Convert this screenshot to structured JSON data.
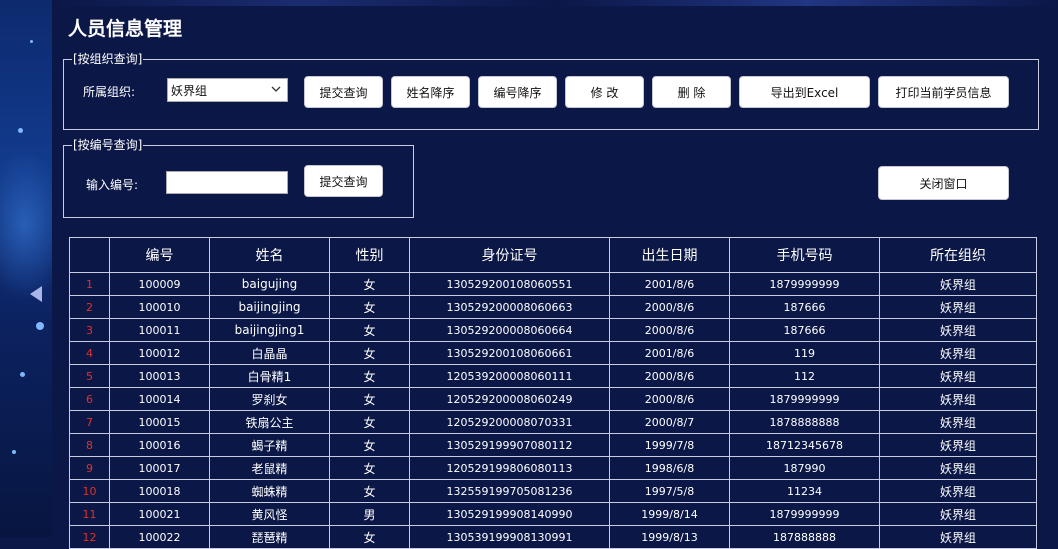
{
  "page": {
    "title": "人员信息管理"
  },
  "org_query": {
    "legend": "[按组织查询]",
    "org_label": "所属组织:",
    "org_select_value": "妖界组",
    "buttons": {
      "submit": "提交查询",
      "sort_name": "姓名降序",
      "sort_id": "编号降序",
      "edit": "修 改",
      "delete": "删 除",
      "export": "导出到Excel",
      "print": "打印当前学员信息"
    }
  },
  "id_query": {
    "legend": "[按编号查询]",
    "id_label": "输入编号:",
    "id_value": "",
    "submit": "提交查询"
  },
  "close_window": "关闭窗口",
  "table": {
    "headers": [
      "编号",
      "姓名",
      "性别",
      "身份证号",
      "出生日期",
      "手机号码",
      "所在组织"
    ],
    "rows": [
      {
        "n": "1",
        "id": "100009",
        "name": "baigujing",
        "gender": "女",
        "idcard": "130529200108060551",
        "birth": "2001/8/6",
        "phone": "1879999999",
        "org": "妖界组"
      },
      {
        "n": "2",
        "id": "100010",
        "name": "baijingjing",
        "gender": "女",
        "idcard": "130529200008060663",
        "birth": "2000/8/6",
        "phone": "187666",
        "org": "妖界组"
      },
      {
        "n": "3",
        "id": "100011",
        "name": "baijingjing1",
        "gender": "女",
        "idcard": "130529200008060664",
        "birth": "2000/8/6",
        "phone": "187666",
        "org": "妖界组"
      },
      {
        "n": "4",
        "id": "100012",
        "name": "白晶晶",
        "gender": "女",
        "idcard": "130529200108060661",
        "birth": "2001/8/6",
        "phone": "119",
        "org": "妖界组"
      },
      {
        "n": "5",
        "id": "100013",
        "name": "白骨精1",
        "gender": "女",
        "idcard": "120539200008060111",
        "birth": "2000/8/6",
        "phone": "112",
        "org": "妖界组"
      },
      {
        "n": "6",
        "id": "100014",
        "name": "罗刹女",
        "gender": "女",
        "idcard": "120529200008060249",
        "birth": "2000/8/6",
        "phone": "1879999999",
        "org": "妖界组"
      },
      {
        "n": "7",
        "id": "100015",
        "name": "铁扇公主",
        "gender": "女",
        "idcard": "120529200008070331",
        "birth": "2000/8/7",
        "phone": "1878888888",
        "org": "妖界组"
      },
      {
        "n": "8",
        "id": "100016",
        "name": "蝎子精",
        "gender": "女",
        "idcard": "130529199907080112",
        "birth": "1999/7/8",
        "phone": "18712345678",
        "org": "妖界组"
      },
      {
        "n": "9",
        "id": "100017",
        "name": "老鼠精",
        "gender": "女",
        "idcard": "120529199806080113",
        "birth": "1998/6/8",
        "phone": "187990",
        "org": "妖界组"
      },
      {
        "n": "10",
        "id": "100018",
        "name": "蜘蛛精",
        "gender": "女",
        "idcard": "132559199705081236",
        "birth": "1997/5/8",
        "phone": "11234",
        "org": "妖界组"
      },
      {
        "n": "11",
        "id": "100021",
        "name": "黄风怪",
        "gender": "男",
        "idcard": "130529199908140990",
        "birth": "1999/8/14",
        "phone": "1879999999",
        "org": "妖界组"
      },
      {
        "n": "12",
        "id": "100022",
        "name": "琵琶精",
        "gender": "女",
        "idcard": "130539199908130991",
        "birth": "1999/8/13",
        "phone": "187888888",
        "org": "妖界组"
      }
    ]
  }
}
